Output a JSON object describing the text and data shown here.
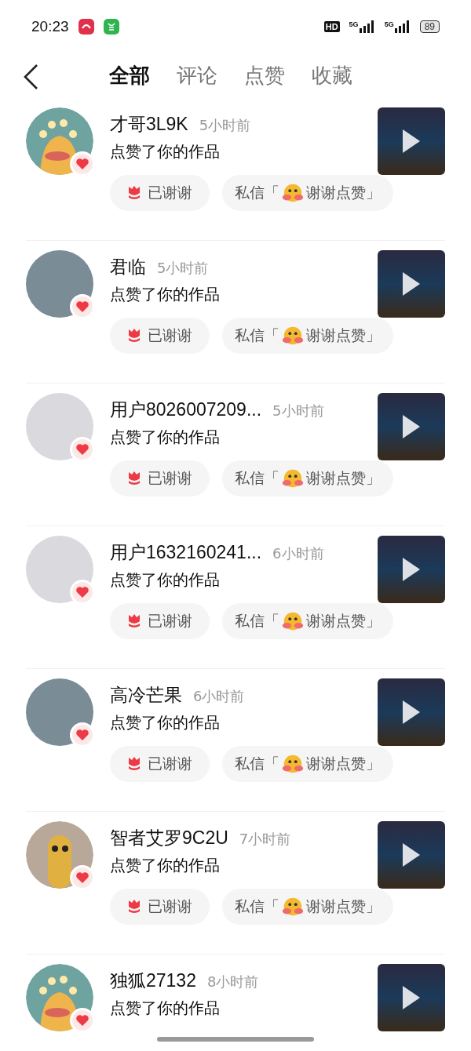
{
  "status_bar": {
    "time": "20:23",
    "hd": "HD",
    "network_1": "5G",
    "network_2": "5G",
    "battery": "89"
  },
  "tabs": [
    {
      "label": "全部",
      "selected": true
    },
    {
      "label": "评论",
      "selected": false
    },
    {
      "label": "点赞",
      "selected": false
    },
    {
      "label": "收藏",
      "selected": false
    }
  ],
  "notifications": [
    {
      "avatar": {
        "kind": "cartoon"
      },
      "name": "才哥3L9K",
      "time": "5小时前",
      "action": "点赞了你的作品",
      "thanks_button": {
        "label": "已谢谢"
      },
      "message_button": {
        "prefix": "私信「",
        "suffix": "谢谢点赞」"
      }
    },
    {
      "avatar": {
        "kind": "photo"
      },
      "name": "君临",
      "time": "5小时前",
      "action": "点赞了你的作品",
      "thanks_button": {
        "label": "已谢谢"
      },
      "message_button": {
        "prefix": "私信「",
        "suffix": "谢谢点赞」"
      }
    },
    {
      "avatar": {
        "kind": "blank"
      },
      "name": "用户8026007209...",
      "time": "5小时前",
      "action": "点赞了你的作品",
      "thanks_button": {
        "label": "已谢谢"
      },
      "message_button": {
        "prefix": "私信「",
        "suffix": "谢谢点赞」"
      }
    },
    {
      "avatar": {
        "kind": "blank"
      },
      "name": "用户1632160241...",
      "time": "6小时前",
      "action": "点赞了你的作品",
      "thanks_button": {
        "label": "已谢谢"
      },
      "message_button": {
        "prefix": "私信「",
        "suffix": "谢谢点赞」"
      }
    },
    {
      "avatar": {
        "kind": "photo"
      },
      "name": "高冷芒果",
      "time": "6小时前",
      "action": "点赞了你的作品",
      "thanks_button": {
        "label": "已谢谢"
      },
      "message_button": {
        "prefix": "私信「",
        "suffix": "谢谢点赞」"
      }
    },
    {
      "avatar": {
        "kind": "mascot"
      },
      "name": "智者艾罗9C2U",
      "time": "7小时前",
      "action": "点赞了你的作品",
      "thanks_button": {
        "label": "已谢谢"
      },
      "message_button": {
        "prefix": "私信「",
        "suffix": "谢谢点赞」"
      }
    },
    {
      "avatar": {
        "kind": "cartoon"
      },
      "name": "独狐27132",
      "time": "8小时前",
      "action": "点赞了你的作品"
    }
  ]
}
